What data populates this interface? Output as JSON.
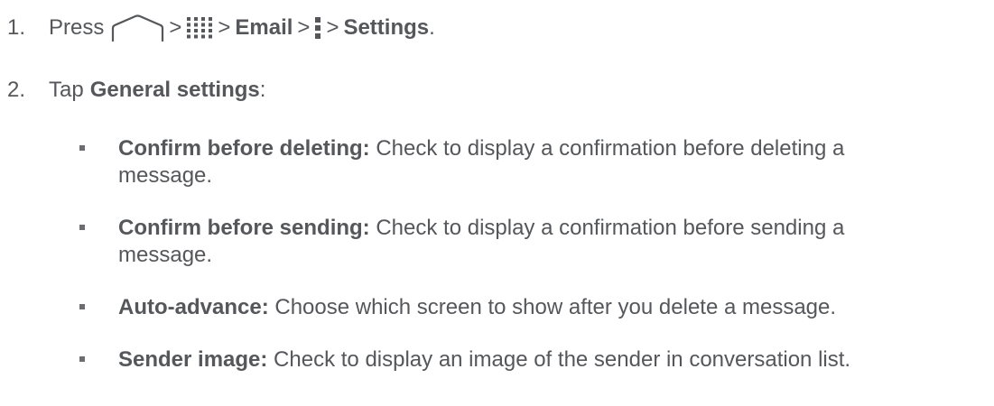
{
  "steps": [
    {
      "number": "1.",
      "prefix": "Press",
      "email": "Email",
      "settings": "Settings",
      "end": ".",
      "sep": ">",
      "icons": [
        "home-icon",
        "apps-grid-icon",
        "menu-dots-icon"
      ]
    },
    {
      "number": "2.",
      "prefix": "Tap",
      "bold": "General settings",
      "end": ":"
    }
  ],
  "items": [
    {
      "term": "Confirm before deleting:",
      "line1": " Check to display a confirmation before deleting a",
      "line2": "message."
    },
    {
      "term": "Confirm before sending:",
      "line1": " Check to display a confirmation before sending a",
      "line2": "message."
    },
    {
      "term": "Auto-advance:",
      "line1": " Choose which screen to show after you delete a message."
    },
    {
      "term": "Sender image:",
      "line1": " Check to display an image of the sender in conversation list."
    }
  ],
  "colors": {
    "text": "#55575a",
    "icon": "#6b6d70"
  }
}
